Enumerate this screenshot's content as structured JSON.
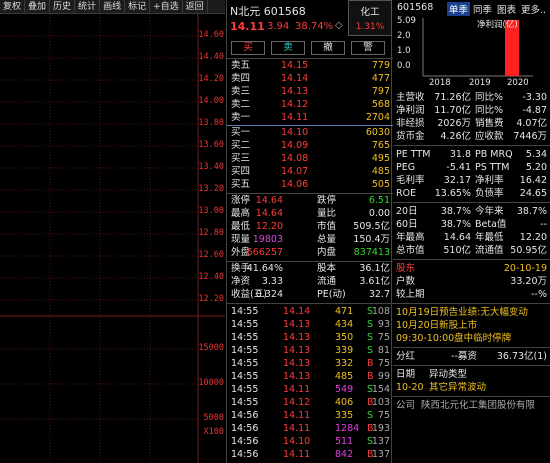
{
  "toolbar": {
    "items": [
      "复权",
      "叠加",
      "历史",
      "统计",
      "画线",
      "标记",
      "+自选",
      "返回"
    ]
  },
  "price_axis": [
    "14.60",
    "14.40",
    "14.20",
    "14.00",
    "13.80",
    "13.60",
    "13.40",
    "13.20",
    "13.00",
    "12.80",
    "12.60",
    "12.40",
    "12.20"
  ],
  "volume_axis": [
    "15000",
    "10000",
    "5000",
    "X100"
  ],
  "header": {
    "name": "N北元 601568",
    "sector": "化工",
    "sector_pct": "1.31%",
    "price": "14.11",
    "change": "3.94",
    "pct": "38.74%",
    "diamond": "◇"
  },
  "buttons": {
    "buy": "买",
    "sell": "卖",
    "cancel": "撤",
    "alert": "警"
  },
  "asks": [
    {
      "label": "卖五",
      "price": "14.15",
      "vol": "779"
    },
    {
      "label": "卖四",
      "price": "14.14",
      "vol": "477"
    },
    {
      "label": "卖三",
      "price": "14.13",
      "vol": "797"
    },
    {
      "label": "卖二",
      "price": "14.12",
      "vol": "568"
    },
    {
      "label": "卖一",
      "price": "14.11",
      "vol": "2704"
    }
  ],
  "bids": [
    {
      "label": "买一",
      "price": "14.10",
      "vol": "6030"
    },
    {
      "label": "买二",
      "price": "14.09",
      "vol": "765"
    },
    {
      "label": "买三",
      "price": "14.08",
      "vol": "495"
    },
    {
      "label": "买四",
      "price": "14.07",
      "vol": "485"
    },
    {
      "label": "买五",
      "price": "14.06",
      "vol": "505"
    }
  ],
  "stats": [
    {
      "l1": "涨停",
      "v1": "14.64",
      "l2": "跌停",
      "v2": "6.51"
    },
    {
      "l1": "最高",
      "v1": "14.64",
      "l2": "量比",
      "v2": "0.00"
    },
    {
      "l1": "最低",
      "v1": "12.20",
      "l2": "市值",
      "v2": "509.5亿"
    },
    {
      "l1": "现量",
      "v1": "19803",
      "l2": "总量",
      "v2": "150.4万"
    },
    {
      "l1": "外盘",
      "v1": "666257",
      "l2": "内盘",
      "v2": "837413"
    }
  ],
  "stats2": [
    {
      "l1": "换手",
      "v1": "41.64%",
      "l2": "股本",
      "v2": "36.1亿"
    },
    {
      "l1": "净资",
      "v1": "3.33",
      "l2": "流通",
      "v2": "3.61亿"
    },
    {
      "l1": "收益(三)",
      "v1": "0.324",
      "l2": "PE(动)",
      "v2": "32.7"
    }
  ],
  "ticks": [
    {
      "t": "14:55",
      "p": "14.14",
      "v": "471",
      "d": "S",
      "n": "108"
    },
    {
      "t": "14:55",
      "p": "14.13",
      "v": "434",
      "d": "S",
      "n": "93"
    },
    {
      "t": "14:55",
      "p": "14.13",
      "v": "350",
      "d": "S",
      "n": "75"
    },
    {
      "t": "14:55",
      "p": "14.13",
      "v": "339",
      "d": "S",
      "n": "81"
    },
    {
      "t": "14:55",
      "p": "14.13",
      "v": "332",
      "d": "B",
      "n": "75"
    },
    {
      "t": "14:55",
      "p": "14.13",
      "v": "485",
      "d": "B",
      "n": "99"
    },
    {
      "t": "14:55",
      "p": "14.11",
      "v": "549",
      "d": "S",
      "n": "154"
    },
    {
      "t": "14:55",
      "p": "14.12",
      "v": "406",
      "d": "B",
      "n": "103"
    },
    {
      "t": "14:56",
      "p": "14.11",
      "v": "335",
      "d": "S",
      "n": "75"
    },
    {
      "t": "14:56",
      "p": "14.11",
      "v": "1284",
      "d": "B",
      "n": "193"
    },
    {
      "t": "14:56",
      "p": "14.10",
      "v": "511",
      "d": "S",
      "n": "137"
    },
    {
      "t": "14:56",
      "p": "14.11",
      "v": "842",
      "d": "B",
      "n": "137"
    }
  ],
  "right": {
    "code": "601568",
    "tabs": [
      "单季",
      "同季",
      "图表",
      "更多.."
    ],
    "bar_chart": {
      "ylabels": [
        "5.09",
        "2.0",
        "1.0",
        "0.0"
      ],
      "legend": "净利润(亿)",
      "years": [
        "2018",
        "2019",
        "2020"
      ]
    },
    "fin": [
      {
        "l1": "主营收",
        "v1": "71.26亿",
        "l2": "同比%",
        "v2": "-3.30"
      },
      {
        "l1": "净利润",
        "v1": "11.70亿",
        "l2": "同比%",
        "v2": "-4.87"
      },
      {
        "l1": "非经损",
        "v1": "2026万",
        "l2": "销售费",
        "v2": "4.07亿"
      },
      {
        "l1": "货币金",
        "v1": "4.26亿",
        "l2": "应收款",
        "v2": "7446万"
      }
    ],
    "val": [
      {
        "l1": "PE TTM",
        "v1": "31.8",
        "l2": "PB MRQ",
        "v2": "5.34"
      },
      {
        "l1": "PEG",
        "v1": "-5.41",
        "l2": "PS TTM",
        "v2": "5.20"
      },
      {
        "l1": "毛利率",
        "v1": "32.17",
        "l2": "净利率",
        "v2": "16.42"
      },
      {
        "l1": "ROE",
        "v1": "13.65%",
        "l2": "负债率",
        "v2": "24.65"
      }
    ],
    "perf": [
      {
        "l1": "20日",
        "v1": "38.7%",
        "l2": "今年来",
        "v2": "38.7%"
      },
      {
        "l1": "60日",
        "v1": "38.7%",
        "l2": "Beta值",
        "v2": "--"
      },
      {
        "l1": "年最高",
        "v1": "14.64",
        "l2": "年最低",
        "v2": "12.20"
      },
      {
        "l1": "总市值",
        "v1": "510亿",
        "l2": "流通值",
        "v2": "50.95亿"
      }
    ],
    "holder": [
      {
        "l": "股东",
        "v": "20-10-19"
      },
      {
        "l": "户数",
        "v": "33.20万"
      },
      {
        "l": "较上期",
        "v": "--%"
      }
    ],
    "news": [
      "10月19日预告业绩:无大幅变动",
      "10月20日新股上市",
      "09:30-10:00盘中临时停牌"
    ],
    "dividend": {
      "l": "分红",
      "m": "--募资",
      "v": "36.73亿(1)"
    },
    "events_header": {
      "a": "日期",
      "b": "异动类型"
    },
    "event": {
      "a": "10-20",
      "b": "其它异常波动"
    },
    "company": {
      "l": "公司",
      "v": "陕西北元化工集团股份有限"
    }
  },
  "colors": {
    "up": "#ff3b3b",
    "down": "#33d633",
    "accent": "#f0c020"
  }
}
